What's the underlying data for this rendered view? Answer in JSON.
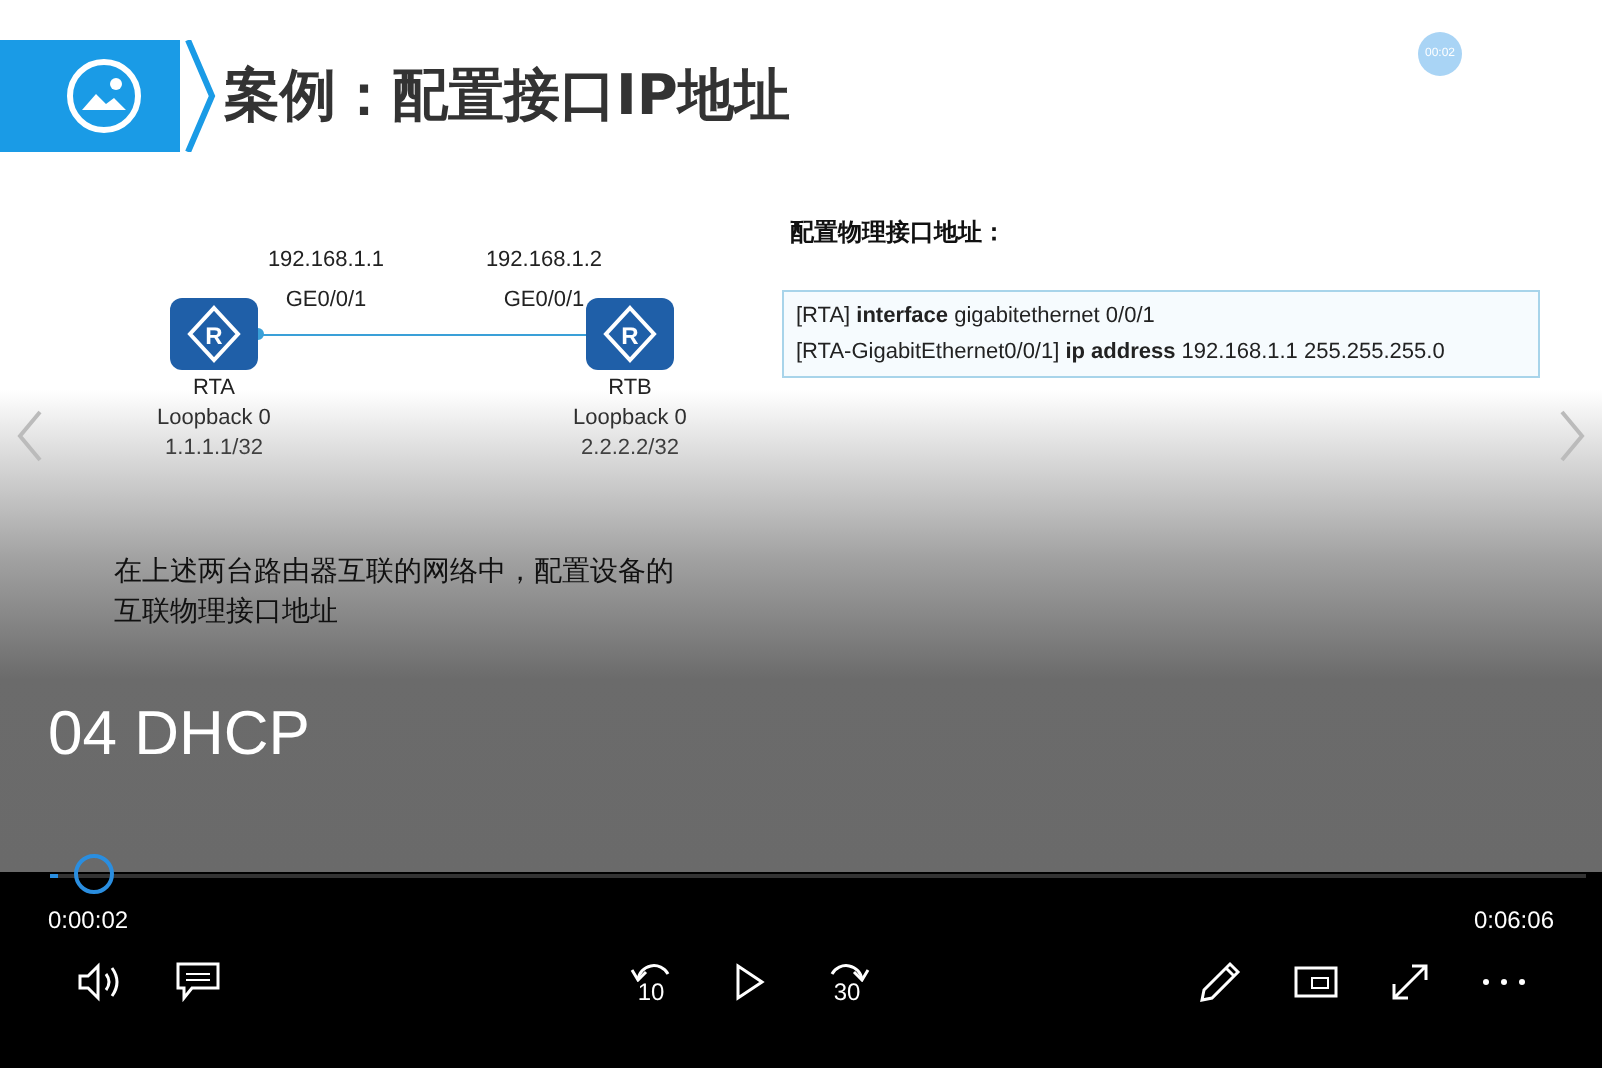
{
  "slide": {
    "title": "案例：配置接口IP地址",
    "badge": "00:02",
    "routers": [
      {
        "name": "RTA",
        "symbol": "R",
        "ip": "192.168.1.1",
        "port": "GE0/0/1",
        "loopback": "Loopback 0",
        "loopback_ip": "1.1.1.1/32"
      },
      {
        "name": "RTB",
        "symbol": "R",
        "ip": "192.168.1.2",
        "port": "GE0/0/1",
        "loopback": "Loopback 0",
        "loopback_ip": "2.2.2.2/32"
      }
    ],
    "config": {
      "heading": "配置物理接口地址：",
      "lines": [
        "[RTA] **interface** gigabitethernet 0/0/1",
        "[RTA-GigabitEthernet0/0/1] **ip address** 192.168.1.1 255.255.255.0"
      ]
    },
    "task": "在上述两台路由器互联的网络中，配置设备的互联物理接口地址"
  },
  "chapter": "04 DHCP",
  "player": {
    "level": 0.005,
    "elapsed": "0:00:02",
    "duration": "0:06:06",
    "back_skip": "10",
    "forward_skip": "30"
  }
}
